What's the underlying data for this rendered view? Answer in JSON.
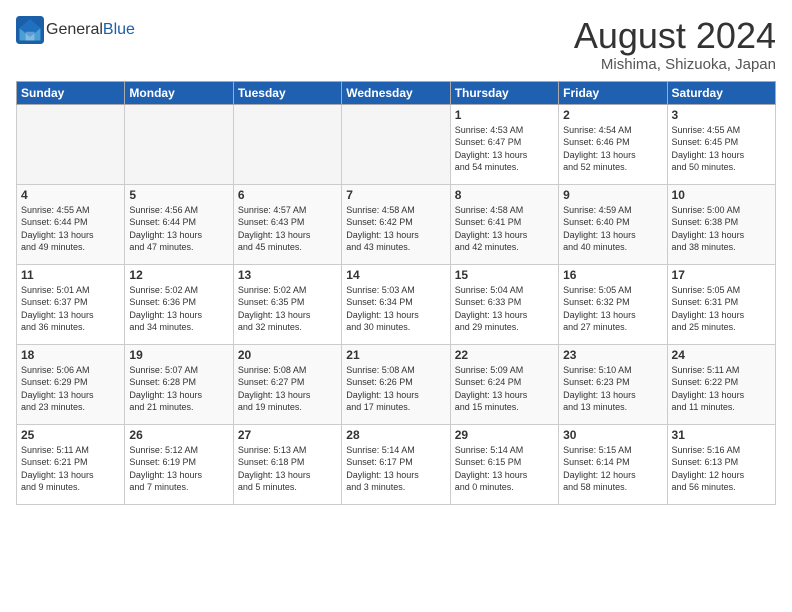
{
  "logo": {
    "general": "General",
    "blue": "Blue"
  },
  "header": {
    "title": "August 2024",
    "location": "Mishima, Shizuoka, Japan"
  },
  "days_of_week": [
    "Sunday",
    "Monday",
    "Tuesday",
    "Wednesday",
    "Thursday",
    "Friday",
    "Saturday"
  ],
  "weeks": [
    [
      {
        "day": "",
        "info": ""
      },
      {
        "day": "",
        "info": ""
      },
      {
        "day": "",
        "info": ""
      },
      {
        "day": "",
        "info": ""
      },
      {
        "day": "1",
        "info": "Sunrise: 4:53 AM\nSunset: 6:47 PM\nDaylight: 13 hours\nand 54 minutes."
      },
      {
        "day": "2",
        "info": "Sunrise: 4:54 AM\nSunset: 6:46 PM\nDaylight: 13 hours\nand 52 minutes."
      },
      {
        "day": "3",
        "info": "Sunrise: 4:55 AM\nSunset: 6:45 PM\nDaylight: 13 hours\nand 50 minutes."
      }
    ],
    [
      {
        "day": "4",
        "info": "Sunrise: 4:55 AM\nSunset: 6:44 PM\nDaylight: 13 hours\nand 49 minutes."
      },
      {
        "day": "5",
        "info": "Sunrise: 4:56 AM\nSunset: 6:44 PM\nDaylight: 13 hours\nand 47 minutes."
      },
      {
        "day": "6",
        "info": "Sunrise: 4:57 AM\nSunset: 6:43 PM\nDaylight: 13 hours\nand 45 minutes."
      },
      {
        "day": "7",
        "info": "Sunrise: 4:58 AM\nSunset: 6:42 PM\nDaylight: 13 hours\nand 43 minutes."
      },
      {
        "day": "8",
        "info": "Sunrise: 4:58 AM\nSunset: 6:41 PM\nDaylight: 13 hours\nand 42 minutes."
      },
      {
        "day": "9",
        "info": "Sunrise: 4:59 AM\nSunset: 6:40 PM\nDaylight: 13 hours\nand 40 minutes."
      },
      {
        "day": "10",
        "info": "Sunrise: 5:00 AM\nSunset: 6:38 PM\nDaylight: 13 hours\nand 38 minutes."
      }
    ],
    [
      {
        "day": "11",
        "info": "Sunrise: 5:01 AM\nSunset: 6:37 PM\nDaylight: 13 hours\nand 36 minutes."
      },
      {
        "day": "12",
        "info": "Sunrise: 5:02 AM\nSunset: 6:36 PM\nDaylight: 13 hours\nand 34 minutes."
      },
      {
        "day": "13",
        "info": "Sunrise: 5:02 AM\nSunset: 6:35 PM\nDaylight: 13 hours\nand 32 minutes."
      },
      {
        "day": "14",
        "info": "Sunrise: 5:03 AM\nSunset: 6:34 PM\nDaylight: 13 hours\nand 30 minutes."
      },
      {
        "day": "15",
        "info": "Sunrise: 5:04 AM\nSunset: 6:33 PM\nDaylight: 13 hours\nand 29 minutes."
      },
      {
        "day": "16",
        "info": "Sunrise: 5:05 AM\nSunset: 6:32 PM\nDaylight: 13 hours\nand 27 minutes."
      },
      {
        "day": "17",
        "info": "Sunrise: 5:05 AM\nSunset: 6:31 PM\nDaylight: 13 hours\nand 25 minutes."
      }
    ],
    [
      {
        "day": "18",
        "info": "Sunrise: 5:06 AM\nSunset: 6:29 PM\nDaylight: 13 hours\nand 23 minutes."
      },
      {
        "day": "19",
        "info": "Sunrise: 5:07 AM\nSunset: 6:28 PM\nDaylight: 13 hours\nand 21 minutes."
      },
      {
        "day": "20",
        "info": "Sunrise: 5:08 AM\nSunset: 6:27 PM\nDaylight: 13 hours\nand 19 minutes."
      },
      {
        "day": "21",
        "info": "Sunrise: 5:08 AM\nSunset: 6:26 PM\nDaylight: 13 hours\nand 17 minutes."
      },
      {
        "day": "22",
        "info": "Sunrise: 5:09 AM\nSunset: 6:24 PM\nDaylight: 13 hours\nand 15 minutes."
      },
      {
        "day": "23",
        "info": "Sunrise: 5:10 AM\nSunset: 6:23 PM\nDaylight: 13 hours\nand 13 minutes."
      },
      {
        "day": "24",
        "info": "Sunrise: 5:11 AM\nSunset: 6:22 PM\nDaylight: 13 hours\nand 11 minutes."
      }
    ],
    [
      {
        "day": "25",
        "info": "Sunrise: 5:11 AM\nSunset: 6:21 PM\nDaylight: 13 hours\nand 9 minutes."
      },
      {
        "day": "26",
        "info": "Sunrise: 5:12 AM\nSunset: 6:19 PM\nDaylight: 13 hours\nand 7 minutes."
      },
      {
        "day": "27",
        "info": "Sunrise: 5:13 AM\nSunset: 6:18 PM\nDaylight: 13 hours\nand 5 minutes."
      },
      {
        "day": "28",
        "info": "Sunrise: 5:14 AM\nSunset: 6:17 PM\nDaylight: 13 hours\nand 3 minutes."
      },
      {
        "day": "29",
        "info": "Sunrise: 5:14 AM\nSunset: 6:15 PM\nDaylight: 13 hours\nand 0 minutes."
      },
      {
        "day": "30",
        "info": "Sunrise: 5:15 AM\nSunset: 6:14 PM\nDaylight: 12 hours\nand 58 minutes."
      },
      {
        "day": "31",
        "info": "Sunrise: 5:16 AM\nSunset: 6:13 PM\nDaylight: 12 hours\nand 56 minutes."
      }
    ]
  ]
}
